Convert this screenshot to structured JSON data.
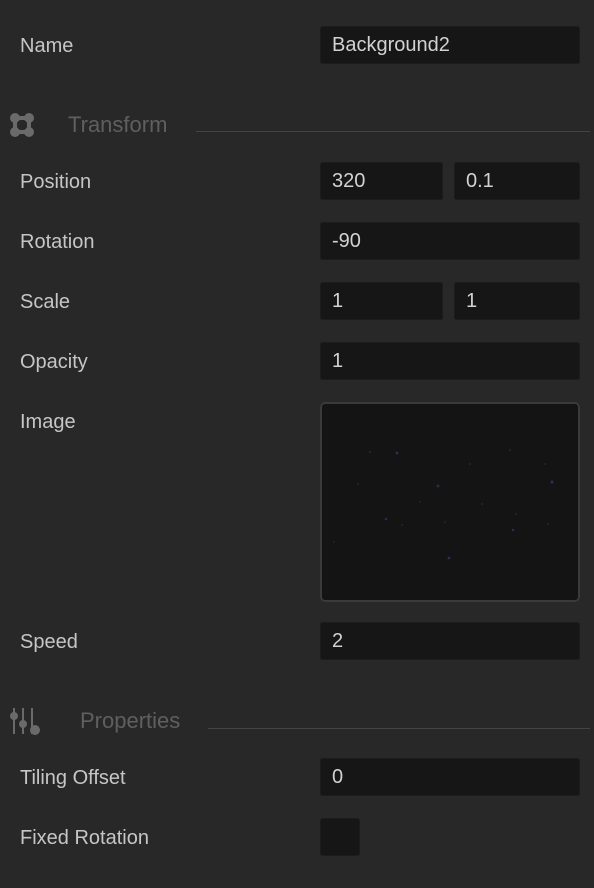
{
  "name_row": {
    "label": "Name",
    "value": "Background2"
  },
  "transform": {
    "title": "Transform",
    "icon": "transform-icon",
    "position": {
      "label": "Position",
      "x": "320",
      "y": "0.1"
    },
    "rotation": {
      "label": "Rotation",
      "value": "-90"
    },
    "scale": {
      "label": "Scale",
      "x": "1",
      "y": "1"
    },
    "opacity": {
      "label": "Opacity",
      "value": "1"
    }
  },
  "image_row": {
    "label": "Image",
    "thumbnail": "starfield-image"
  },
  "speed_row": {
    "label": "Speed",
    "value": "2"
  },
  "properties": {
    "title": "Properties",
    "icon": "sliders-icon",
    "tiling_offset": {
      "label": "Tiling Offset",
      "value": "0"
    },
    "fixed_rotation": {
      "label": "Fixed Rotation",
      "checked": false
    }
  },
  "colors": {
    "panel_bg": "#282828",
    "field_bg": "#161616",
    "label_text": "#c6c6c6",
    "section_text": "#5f5f5f",
    "rule": "#444444"
  }
}
